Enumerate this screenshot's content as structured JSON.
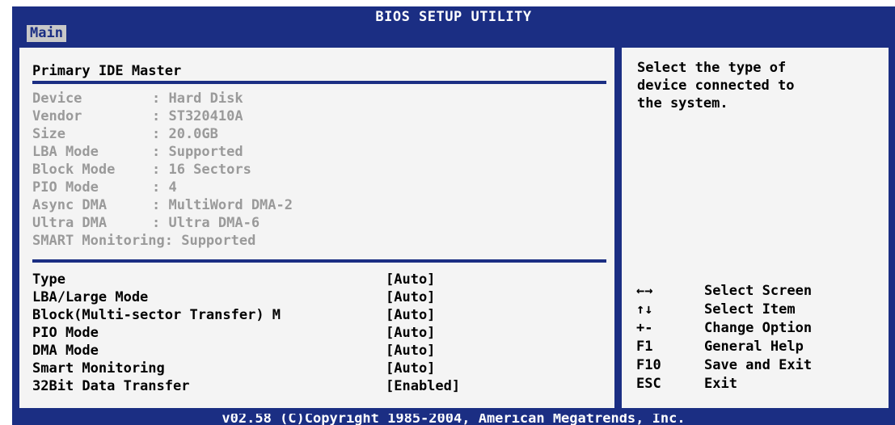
{
  "window": {
    "title": "BIOS SETUP UTILITY"
  },
  "tabs": [
    {
      "label": "Main"
    }
  ],
  "section": {
    "title": "Primary IDE Master"
  },
  "device_info": [
    {
      "key": "Device",
      "value": ": Hard Disk"
    },
    {
      "key": "Vendor",
      "value": ": ST320410A"
    },
    {
      "key": "Size",
      "value": ": 20.0GB"
    },
    {
      "key": "LBA Mode",
      "value": ": Supported"
    },
    {
      "key": "Block Mode",
      "value": ": 16 Sectors"
    },
    {
      "key": "PIO Mode",
      "value": ": 4"
    },
    {
      "key": "Async DMA",
      "value": ": MultiWord DMA-2"
    },
    {
      "key": "Ultra DMA",
      "value": ": Ultra DMA-6"
    }
  ],
  "smart_line": "SMART Monitoring: Supported",
  "options": [
    {
      "label": "Type",
      "value": "[Auto]"
    },
    {
      "label": "LBA/Large Mode",
      "value": "[Auto]"
    },
    {
      "label": "Block(Multi-sector Transfer) M",
      "value": "[Auto]"
    },
    {
      "label": "PIO Mode",
      "value": "[Auto]"
    },
    {
      "label": "DMA Mode",
      "value": "[Auto]"
    },
    {
      "label": "Smart Monitoring",
      "value": "[Auto]"
    },
    {
      "label": "32Bit Data Transfer",
      "value": "[Enabled]"
    }
  ],
  "help": {
    "lines": [
      "Select the type of",
      "device connected to",
      "the system."
    ]
  },
  "keys": [
    {
      "key": "←→",
      "desc": "Select Screen"
    },
    {
      "key": "↑↓",
      "desc": "Select Item"
    },
    {
      "key": "+-",
      "desc": "Change Option"
    },
    {
      "key": "F1",
      "desc": "General Help"
    },
    {
      "key": "F10",
      "desc": "Save and Exit"
    },
    {
      "key": "ESC",
      "desc": "Exit"
    }
  ],
  "footer": "v02.58 (C)Copyright 1985-2004, American Megatrends, Inc.",
  "colors": {
    "bios_blue": "#1b2e83",
    "panel_bg": "#f4f4f4",
    "dim_text": "#9a9a9a"
  }
}
